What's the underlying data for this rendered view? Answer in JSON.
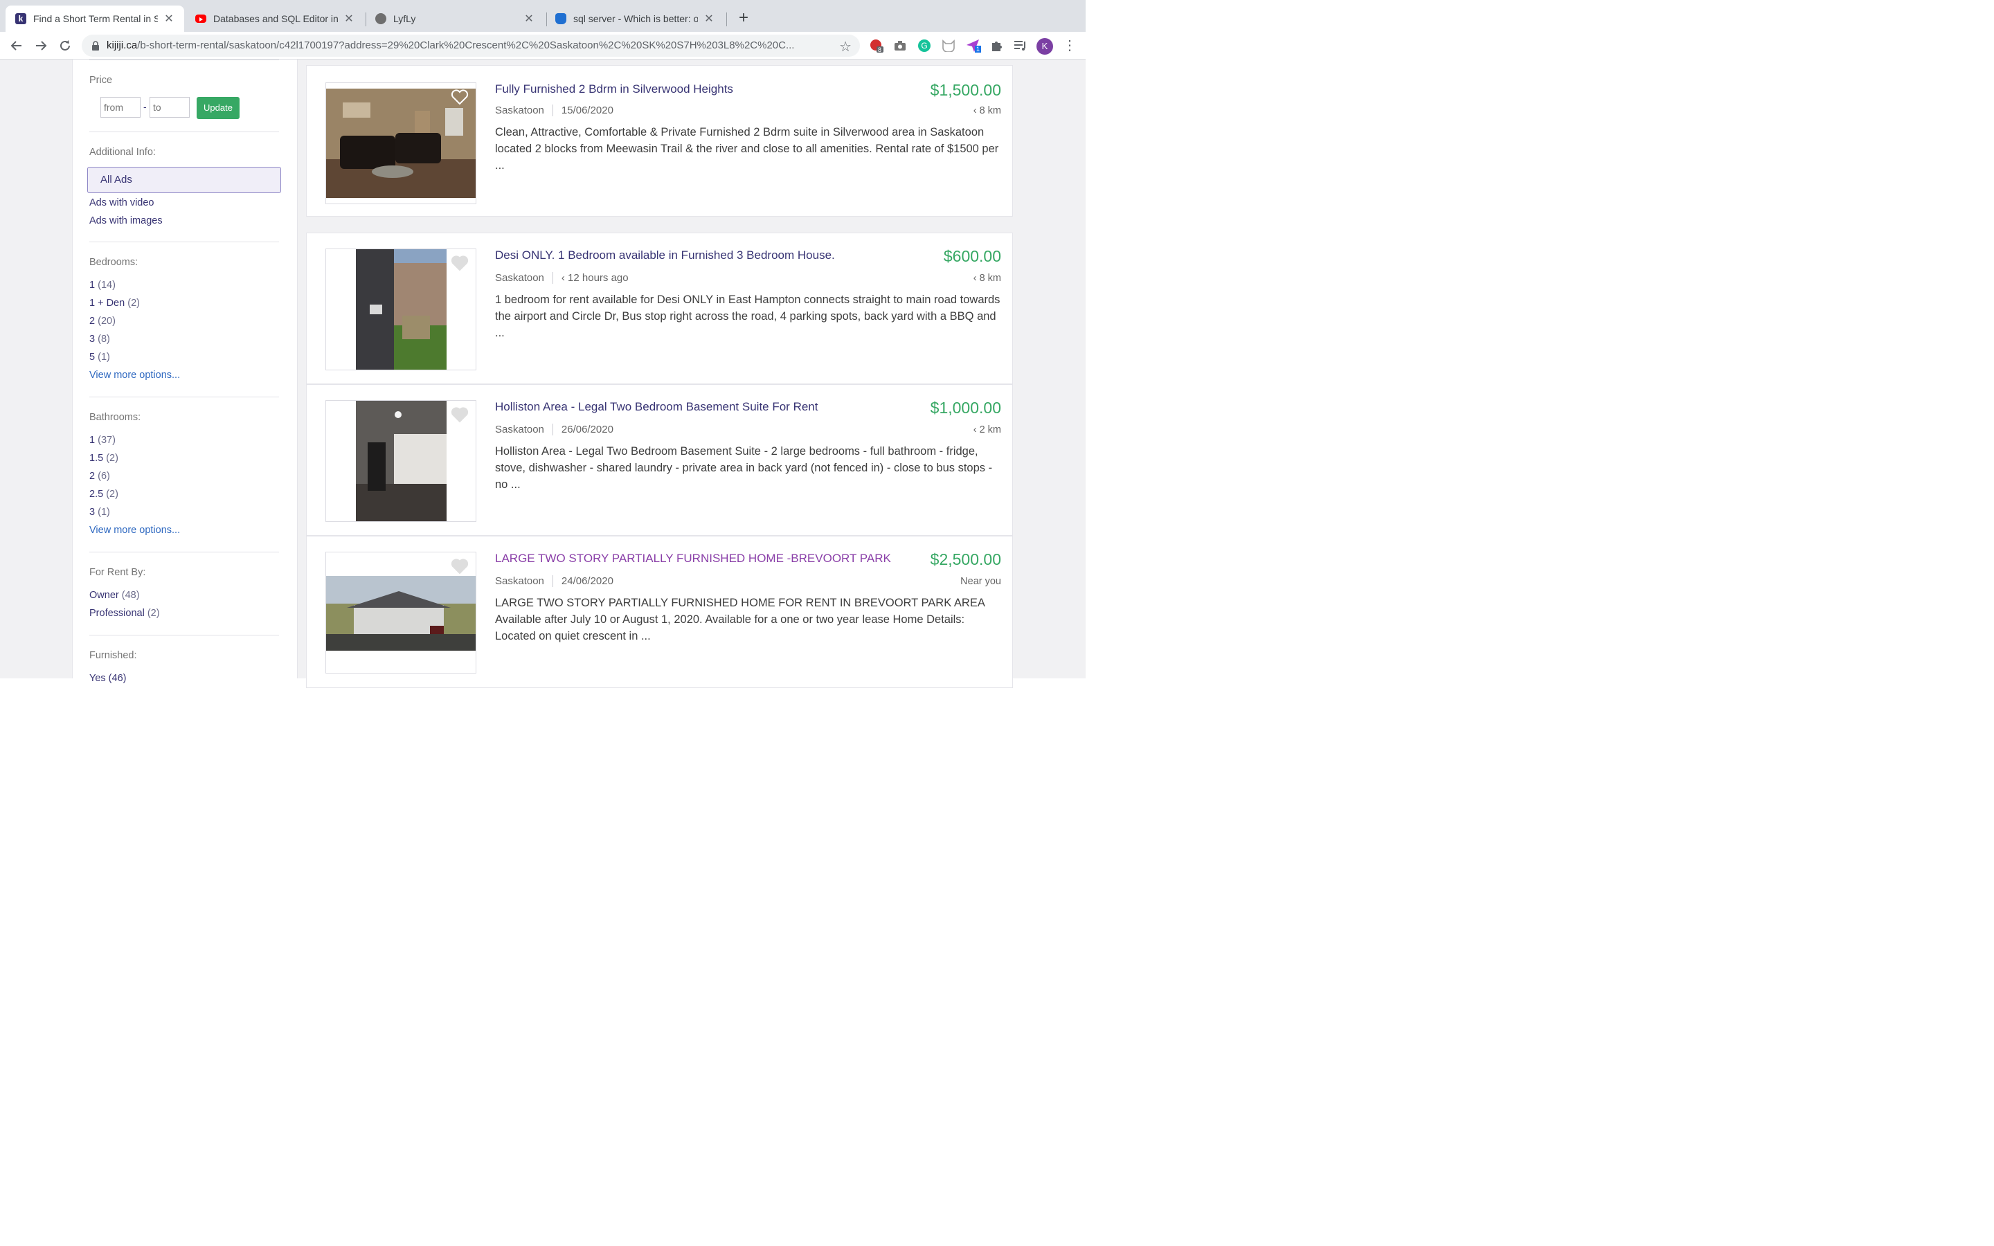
{
  "browser": {
    "tabs": [
      {
        "title": "Find a Short Term Rental in Saskatoon",
        "favicon": "kijiji-icon",
        "active": true
      },
      {
        "title": "Databases and SQL Editor in PyCharm",
        "favicon": "youtube-icon",
        "active": false
      },
      {
        "title": "LyfLy",
        "favicon": "github-icon",
        "active": false
      },
      {
        "title": "sql server - Which is better: on",
        "favicon": "database-icon",
        "active": false
      }
    ],
    "url_host": "kijiji.ca",
    "url_path": "/b-short-term-rental/saskatoon/c42l1700197?address=29%20Clark%20Crescent%2C%20Saskatoon%2C%20SK%20S7H%203L8%2C%20C...",
    "extension_badge_1": "8",
    "extension_badge_2": "1",
    "profile_initial": "K"
  },
  "sidebar": {
    "price": {
      "heading": "Price",
      "from_placeholder": "from",
      "to_placeholder": "to",
      "update_label": "Update"
    },
    "additional_info": {
      "heading": "Additional Info:",
      "selected": "All Ads",
      "items": [
        "Ads with video",
        "Ads with images"
      ]
    },
    "bedrooms": {
      "heading": "Bedrooms:",
      "items": [
        {
          "label": "1",
          "count": "(14)"
        },
        {
          "label": "1 + Den",
          "count": "(2)"
        },
        {
          "label": "2",
          "count": "(20)"
        },
        {
          "label": "3",
          "count": "(8)"
        },
        {
          "label": "5",
          "count": "(1)"
        }
      ],
      "more": "View more options..."
    },
    "bathrooms": {
      "heading": "Bathrooms:",
      "items": [
        {
          "label": "1",
          "count": "(37)"
        },
        {
          "label": "1.5",
          "count": "(2)"
        },
        {
          "label": "2",
          "count": "(6)"
        },
        {
          "label": "2.5",
          "count": "(2)"
        },
        {
          "label": "3",
          "count": "(1)"
        }
      ],
      "more": "View more options..."
    },
    "for_rent_by": {
      "heading": "For Rent By:",
      "items": [
        {
          "label": "Owner",
          "count": "(48)"
        },
        {
          "label": "Professional",
          "count": "(2)"
        }
      ]
    },
    "furnished": {
      "heading": "Furnished:",
      "partial_item": "Yes (46)"
    }
  },
  "listings": [
    {
      "title": "Fully Furnished 2 Bdrm in Silverwood Heights",
      "price": "$1,500.00",
      "location": "Saskatoon",
      "date": "15/06/2020",
      "distance": "‹ 8 km",
      "description": "Clean, Attractive, Comfortable & Private Furnished 2 Bdrm suite in Silverwood area in Saskatoon located 2 blocks from Meewasin Trail & the river and close to all amenities. Rental rate of $1500 per ...",
      "visited": false
    },
    {
      "title": "Desi ONLY. 1 Bedroom available in Furnished 3 Bedroom House.",
      "price": "$600.00",
      "location": "Saskatoon",
      "date": "‹ 12 hours ago",
      "distance": "‹ 8 km",
      "description": "1 bedroom for rent available for Desi ONLY in East Hampton connects straight to main road towards the airport and Circle Dr, Bus stop right across the road, 4 parking spots, back yard with a BBQ and ...",
      "visited": false
    },
    {
      "title": "Holliston Area - Legal Two Bedroom Basement Suite For Rent",
      "price": "$1,000.00",
      "location": "Saskatoon",
      "date": "26/06/2020",
      "distance": "‹ 2 km",
      "description": "Holliston Area - Legal Two Bedroom Basement Suite - 2 large bedrooms - full bathroom - fridge, stove, dishwasher - shared laundry - private area in back yard (not fenced in) - close to bus stops - no ...",
      "visited": false
    },
    {
      "title": "LARGE TWO STORY PARTIALLY FURNISHED HOME -BREVOORT PARK",
      "price": "$2,500.00",
      "location": "Saskatoon",
      "date": "24/06/2020",
      "distance": "Near you",
      "description": "LARGE TWO STORY PARTIALLY FURNISHED HOME FOR RENT IN BREVOORT PARK AREA Available after July 10 or August 1, 2020. Available for a one or two year lease Home Details: Located on quiet crescent in ...",
      "visited": true
    }
  ],
  "colors": {
    "price_green": "#37a864",
    "link_blue": "#2e68c0",
    "title_navy": "#373373",
    "visited_purple": "#8a3fa8"
  }
}
